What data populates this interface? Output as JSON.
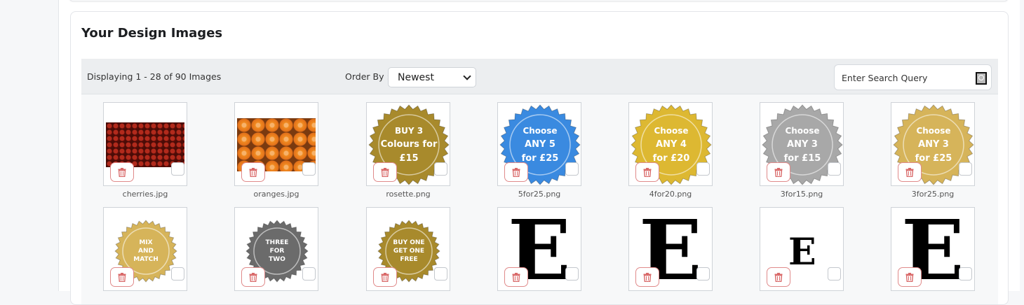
{
  "section": {
    "title": "Your Design Images"
  },
  "toolbar": {
    "display_count": "Displaying 1 - 28 of 90 Images",
    "order_label": "Order By :",
    "order_value": "Newest",
    "search_placeholder": "Enter Search Query"
  },
  "images": [
    {
      "file": "cherries.jpg",
      "kind": "photo-cherries"
    },
    {
      "file": "oranges.jpg",
      "kind": "photo-oranges"
    },
    {
      "file": "rosette.png",
      "kind": "rosette",
      "color": "#a88a2c",
      "lines": [
        "BUY 3",
        "Colours for",
        "£15"
      ]
    },
    {
      "file": "5for25.png",
      "kind": "rosette",
      "color": "#3a8ae0",
      "lines": [
        "Choose",
        "ANY 5",
        "for £25"
      ]
    },
    {
      "file": "4for20.png",
      "kind": "rosette",
      "color": "#ddb832",
      "lines": [
        "Choose",
        "ANY 4",
        "for £20"
      ]
    },
    {
      "file": "3for15.png",
      "kind": "rosette",
      "color": "#a8a8a8",
      "lines": [
        "Choose",
        "ANY 3",
        "for £15"
      ]
    },
    {
      "file": "3for25.png",
      "kind": "rosette",
      "color": "#d6b45a",
      "lines": [
        "Choose",
        "ANY 3",
        "for £25"
      ]
    },
    {
      "file": "",
      "kind": "rosette-small",
      "color": "#d6b45a",
      "lines": [
        "MIX",
        "AND",
        "MATCH"
      ]
    },
    {
      "file": "",
      "kind": "rosette-small",
      "color": "#6b6b6b",
      "lines": [
        "THREE",
        "FOR",
        "TWO"
      ]
    },
    {
      "file": "",
      "kind": "rosette-small",
      "color": "#a88a2c",
      "lines": [
        "BUY ONE",
        "GET ONE",
        "FREE"
      ]
    },
    {
      "file": "",
      "kind": "letter-e",
      "letter": "E",
      "size": "large"
    },
    {
      "file": "",
      "kind": "letter-e",
      "letter": "E",
      "size": "large"
    },
    {
      "file": "",
      "kind": "letter-e",
      "letter": "E",
      "size": "small"
    },
    {
      "file": "",
      "kind": "letter-e",
      "letter": "E",
      "size": "large"
    }
  ],
  "icons": {
    "delete": "trash-icon",
    "search": "search-icon",
    "select_chevron": "chevron-down-icon"
  },
  "colors": {
    "delete_accent": "#e08a8a",
    "toolbar_bg": "#eceef0"
  }
}
